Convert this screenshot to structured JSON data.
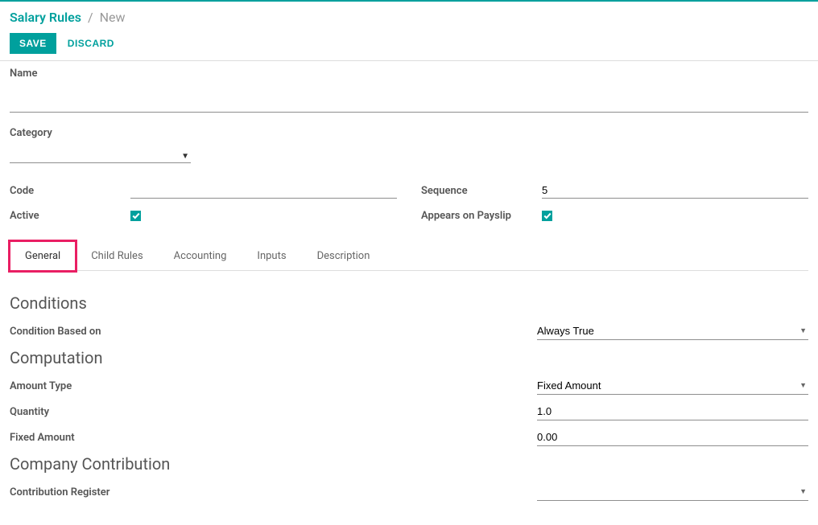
{
  "breadcrumb": {
    "root": "Salary Rules",
    "current": "New"
  },
  "buttons": {
    "save": "SAVE",
    "discard": "DISCARD"
  },
  "fields": {
    "name_label": "Name",
    "name_value": "",
    "category_label": "Category",
    "category_value": "",
    "code_label": "Code",
    "code_value": "",
    "active_label": "Active",
    "sequence_label": "Sequence",
    "sequence_value": "5",
    "appears_label": "Appears on Payslip"
  },
  "tabs": {
    "general": "General",
    "child_rules": "Child Rules",
    "accounting": "Accounting",
    "inputs": "Inputs",
    "description": "Description"
  },
  "sections": {
    "conditions_title": "Conditions",
    "condition_based_label": "Condition Based on",
    "condition_based_value": "Always True",
    "computation_title": "Computation",
    "amount_type_label": "Amount Type",
    "amount_type_value": "Fixed Amount",
    "quantity_label": "Quantity",
    "quantity_value": "1.0",
    "fixed_amount_label": "Fixed Amount",
    "fixed_amount_value": "0.00",
    "company_contrib_title": "Company Contribution",
    "contrib_register_label": "Contribution Register",
    "contrib_register_value": ""
  }
}
